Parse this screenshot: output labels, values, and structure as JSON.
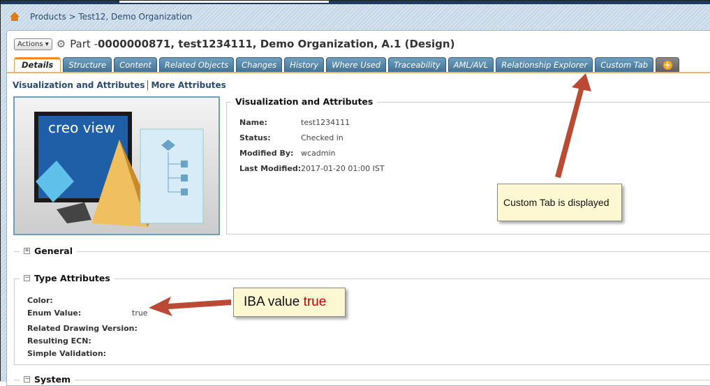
{
  "breadcrumb": {
    "text": "Products > Test12, Demo Organization"
  },
  "header": {
    "actions_label": "Actions ▾",
    "object_type": "Part - ",
    "object_title": "0000000871, test1234111, Demo Organization, A.1 (Design)"
  },
  "tabs": [
    {
      "label": "Details",
      "active": true
    },
    {
      "label": "Structure"
    },
    {
      "label": "Content"
    },
    {
      "label": "Related Objects"
    },
    {
      "label": "Changes"
    },
    {
      "label": "History"
    },
    {
      "label": "Where Used"
    },
    {
      "label": "Traceability"
    },
    {
      "label": "AML/AVL"
    },
    {
      "label": "Relationship Explorer"
    },
    {
      "label": "Custom Tab"
    }
  ],
  "sublinks": [
    "Visualization and Attributes",
    "More Attributes"
  ],
  "thumbnail": {
    "logo": "creo view"
  },
  "visualization": {
    "title": "Visualization and Attributes",
    "fields": [
      {
        "label": "Name:",
        "value": "test1234111"
      },
      {
        "label": "Status:",
        "value": "Checked in"
      },
      {
        "label": "Modified By:",
        "value": "wcadmin"
      },
      {
        "label": "Last Modified:",
        "value": "2017-01-20 01:00 IST"
      }
    ]
  },
  "sections": {
    "general": "General",
    "type_attributes": "Type Attributes",
    "system": "System"
  },
  "type_attributes": [
    {
      "label": "Color:",
      "value": ""
    },
    {
      "label": "Enum Value:",
      "value": "true"
    },
    {
      "label": "Related Drawing Version:",
      "value": ""
    },
    {
      "label": "Resulting ECN:",
      "value": ""
    },
    {
      "label": "Simple Validation:",
      "value": ""
    }
  ],
  "callouts": {
    "custom_tab": "Custom Tab is displayed",
    "iba_prefix": "IBA value ",
    "iba_value": "true"
  },
  "colors": {
    "arrow": "#b94a34",
    "tab": "#4f82a6",
    "accent": "#f08a24"
  }
}
